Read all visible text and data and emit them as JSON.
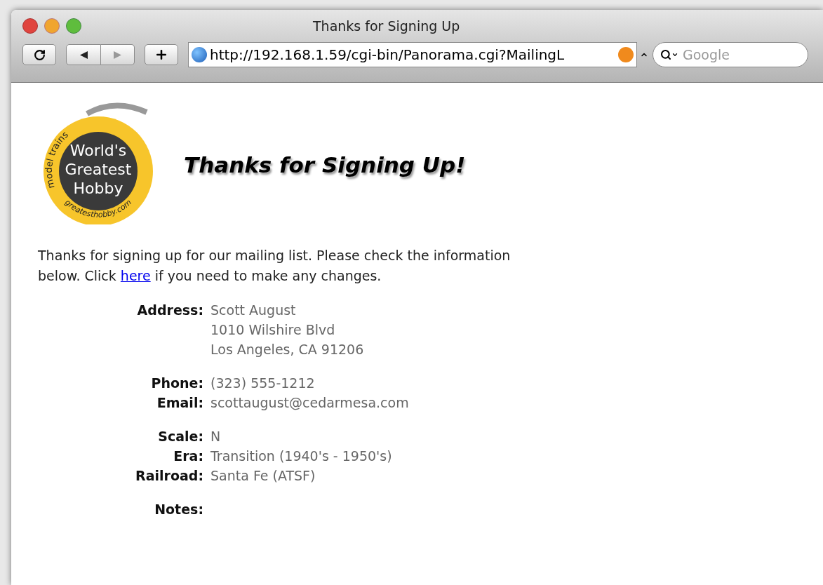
{
  "window": {
    "title": "Thanks for Signing Up"
  },
  "toolbar": {
    "url": "http://192.168.1.59/cgi-bin/Panorama.cgi?MailingL",
    "search": {
      "placeholder": "Google"
    }
  },
  "logo": {
    "lines": [
      "World's",
      "Greatest",
      "Hobby"
    ],
    "top_arc": "model trains",
    "bottom_arc": "greatesthobby.com"
  },
  "heading": "Thanks for Signing Up!",
  "intro": {
    "before": "Thanks for signing up for our mailing list. Please check the information below. Click",
    "link": "here",
    "after": "if you need to make any changes."
  },
  "groups": [
    [
      {
        "label": "Address:",
        "values": [
          "Scott August",
          "1010 Wilshire Blvd",
          "Los Angeles, CA 91206"
        ]
      }
    ],
    [
      {
        "label": "Phone:",
        "values": [
          "(323) 555-1212"
        ]
      },
      {
        "label": "Email:",
        "values": [
          "scottaugust@cedarmesa.com"
        ]
      }
    ],
    [
      {
        "label": "Scale:",
        "values": [
          "N"
        ]
      },
      {
        "label": "Era:",
        "values": [
          "Transition (1940's - 1950's)"
        ]
      },
      {
        "label": "Railroad:",
        "values": [
          "Santa Fe (ATSF)"
        ]
      }
    ],
    [
      {
        "label": "Notes:"
      }
    ]
  ]
}
